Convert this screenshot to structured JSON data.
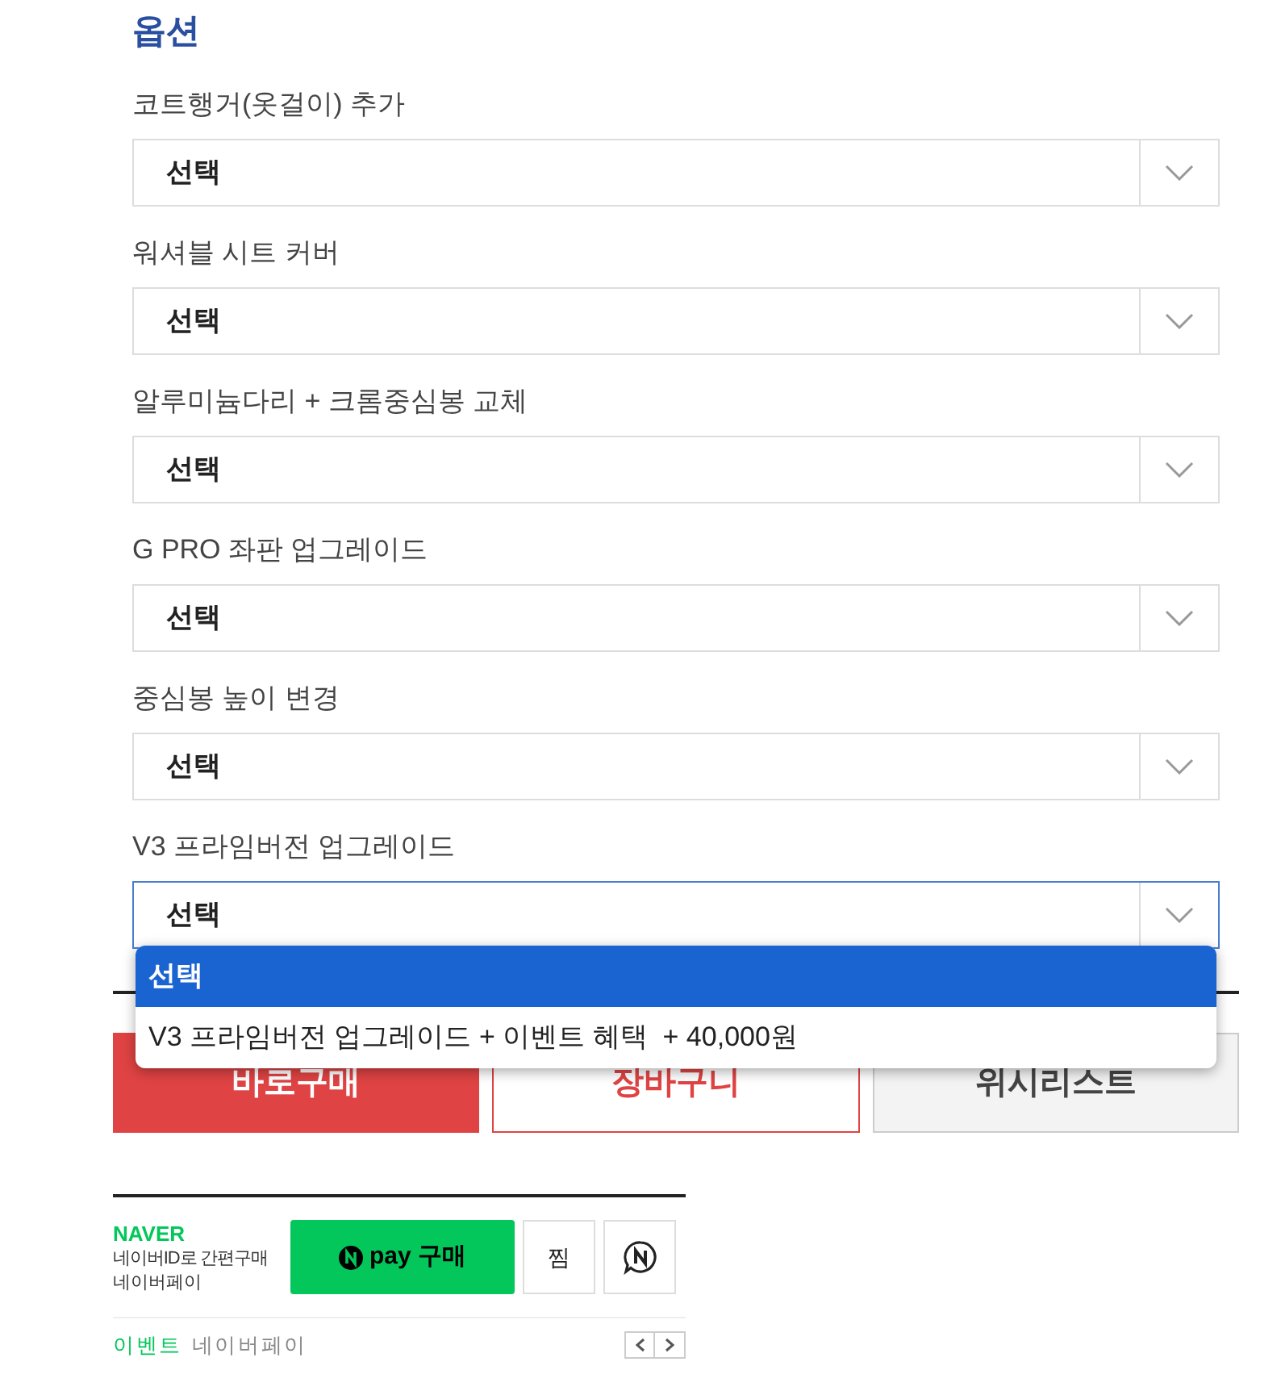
{
  "title": "옵션",
  "options": [
    {
      "label": "코트행거(옷걸이) 추가",
      "value": "선택",
      "expanded": false
    },
    {
      "label": "워셔블 시트 커버",
      "value": "선택",
      "expanded": false
    },
    {
      "label": "알루미늄다리 + 크롬중심봉 교체",
      "value": "선택",
      "expanded": false
    },
    {
      "label": "G PRO 좌판 업그레이드",
      "value": "선택",
      "expanded": false
    },
    {
      "label": "중심봉 높이 변경",
      "value": "선택",
      "expanded": false
    },
    {
      "label": "V3 프라임버전 업그레이드",
      "value": "선택",
      "expanded": true
    }
  ],
  "dropdown": [
    {
      "text": "선택",
      "selected": true
    },
    {
      "text": "V3 프라임버전 업그레이드 + 이벤트 혜택  + 40,000원",
      "selected": false
    }
  ],
  "buttons": [
    {
      "label": "바로구매",
      "kind": "buy"
    },
    {
      "label": "장바구니",
      "kind": "cart"
    },
    {
      "label": "위시리스트",
      "kind": "wish"
    }
  ],
  "naver": {
    "brand": "NAVER",
    "line1": "네이버ID로 간편구매",
    "line2": "네이버페이",
    "pay_label": "pay 구매",
    "zzim": "찜",
    "event_tag": "이벤트",
    "event_text": "네이버페이"
  }
}
